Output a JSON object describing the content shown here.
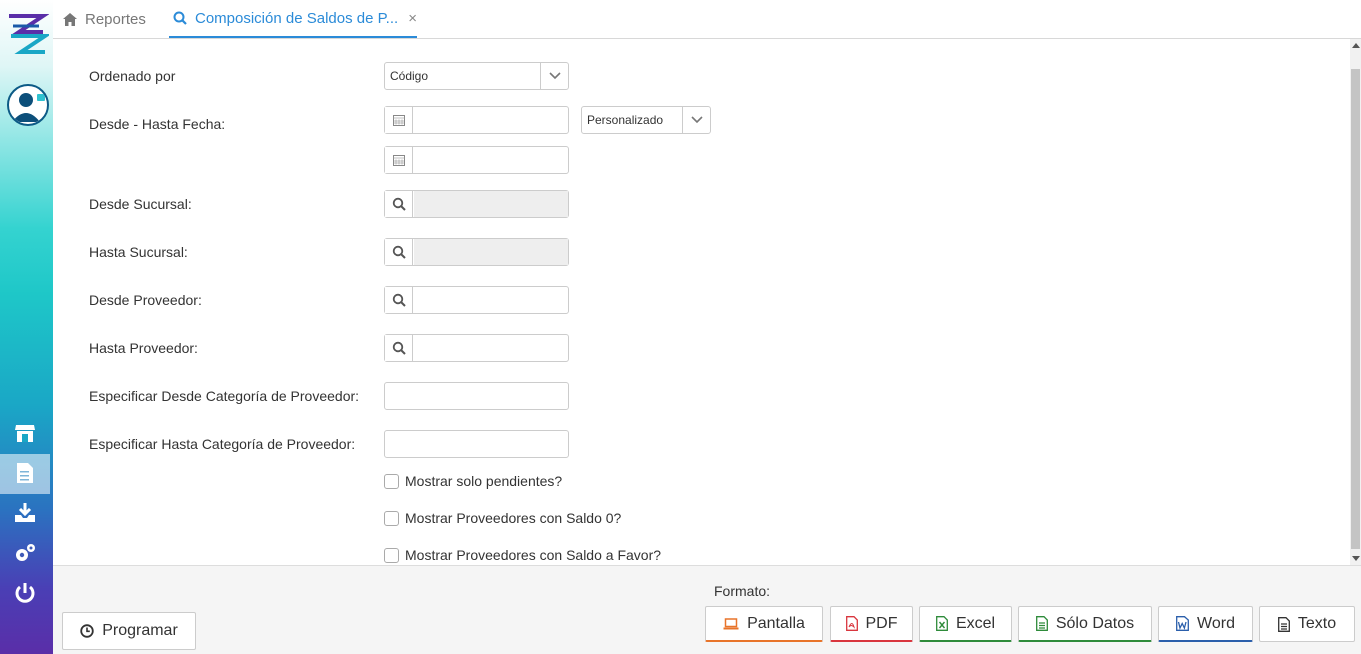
{
  "tabs": [
    {
      "label": "Reportes",
      "icon": "home-icon"
    },
    {
      "label": "Composición de Saldos de P...",
      "icon": "search-icon",
      "close": "×"
    }
  ],
  "form": {
    "ordenado_por_label": "Ordenado por",
    "ordenado_por_value": "Código",
    "fecha_label": "Desde - Hasta Fecha:",
    "fecha_range_value": "Personalizado",
    "desde_sucursal_label": "Desde Sucursal:",
    "hasta_sucursal_label": "Hasta Sucursal:",
    "desde_proveedor_label": "Desde Proveedor:",
    "hasta_proveedor_label": "Hasta Proveedor:",
    "desde_categoria_label": "Especificar Desde Categoría de Proveedor:",
    "hasta_categoria_label": "Especificar Hasta Categoría de Proveedor:",
    "chk_pendientes": "Mostrar solo pendientes?",
    "chk_saldo0": "Mostrar Proveedores con Saldo 0?",
    "chk_saldo_favor": "Mostrar Proveedores con Saldo a Favor?"
  },
  "footer": {
    "programar": "Programar",
    "formato": "Formato:",
    "buttons": {
      "pantalla": "Pantalla",
      "pdf": "PDF",
      "excel": "Excel",
      "solo_datos": "Sólo Datos",
      "word": "Word",
      "texto": "Texto"
    }
  },
  "colors": {
    "accent": "#2b8bd8",
    "pantalla": "#e8742a",
    "pdf": "#d9363e",
    "excel": "#2e8b3a",
    "solo_datos": "#2e8b3a",
    "word": "#2b5fab",
    "texto": "#333333"
  }
}
